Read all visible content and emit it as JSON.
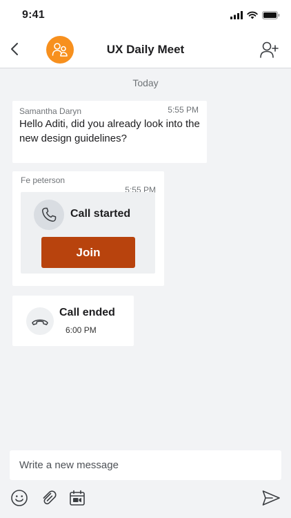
{
  "status_bar": {
    "time": "9:41",
    "icons": [
      "signal-icon",
      "wifi-icon",
      "battery-icon"
    ]
  },
  "header": {
    "back_icon": "chevron-left-icon",
    "avatar_icon": "group-icon",
    "title": "UX Daily Meet",
    "add_user_icon": "add-user-icon",
    "avatar_color": "#f7901e"
  },
  "conversation": {
    "day_divider": "Today",
    "messages": [
      {
        "sender": "Samantha Daryn",
        "time": "5:55 PM",
        "text": "Hello Aditi, did you already look into the new design guidelines?"
      },
      {
        "sender": "Fe peterson",
        "time": "5:55 PM",
        "call_label": "Call started",
        "join_label": "Join",
        "icon": "phone-icon"
      },
      {
        "call_label": "Call ended",
        "time": "6:00 PM",
        "icon": "hang-up-icon"
      }
    ],
    "join_color": "#b8430d"
  },
  "composer": {
    "placeholder": "Write a new message",
    "icons": [
      "emoji-icon",
      "attachment-icon",
      "meeting-icon",
      "send-icon"
    ]
  }
}
